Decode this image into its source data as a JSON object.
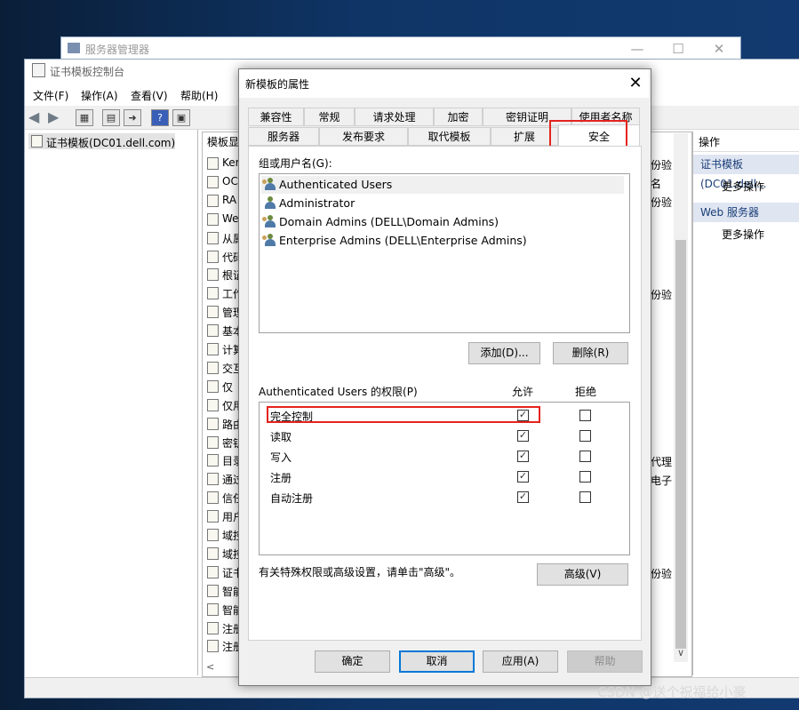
{
  "server_manager": {
    "title": "服务器管理器",
    "controls": [
      "—",
      "☐",
      "✕"
    ]
  },
  "console": {
    "title": "证书模板控制台",
    "menu": [
      "文件(F)",
      "操作(A)",
      "查看(V)",
      "帮助(H)"
    ],
    "tree_root": "证书模板(DC01.dell.com)",
    "list_header": "模板显",
    "list_rows": [
      "Ker",
      "OC",
      "RA",
      "We",
      "从属",
      "代码",
      "根证",
      "工作",
      "管理",
      "基本",
      "计算",
      "交互",
      "仅",
      "仅用",
      "路由",
      "密钥",
      "目录",
      "通过",
      "信任",
      "用户",
      "域控",
      "域控",
      "证书",
      "智能",
      "智能",
      "注册",
      "注册"
    ],
    "right_col": [
      {
        "row": 1,
        "text": "份验"
      },
      {
        "row": 2,
        "text": "名"
      },
      {
        "row": 3,
        "text": "份验"
      },
      {
        "row": 8,
        "text": "份验"
      },
      {
        "row": 17,
        "text": "代理"
      },
      {
        "row": 18,
        "text": "电子"
      },
      {
        "row": 23,
        "text": "份验"
      }
    ],
    "actions": {
      "header": "操作",
      "sections": [
        {
          "title": "证书模板(DC01.dell...",
          "more": "更多操作"
        },
        {
          "title": "Web 服务器",
          "more": "更多操作"
        }
      ]
    }
  },
  "dialog": {
    "title": "新模板的属性",
    "close": "✕",
    "tabs_row1": [
      "兼容性",
      "常规",
      "请求处理",
      "加密",
      "密钥证明",
      "使用者名称"
    ],
    "tabs_row2": [
      "服务器",
      "发布要求",
      "取代模板",
      "扩展",
      "安全"
    ],
    "active_tab": "安全",
    "groups_label": "组或用户名(G):",
    "users": [
      {
        "name": "Authenticated Users",
        "icon": "group-icon"
      },
      {
        "name": "Administrator",
        "icon": "user-icon"
      },
      {
        "name": "Domain Admins (DELL\\Domain Admins)",
        "icon": "group-icon"
      },
      {
        "name": "Enterprise Admins (DELL\\Enterprise Admins)",
        "icon": "group-icon"
      }
    ],
    "add_button": "添加(D)...",
    "remove_button": "删除(R)",
    "perm_label": "Authenticated Users 的权限(P)",
    "allow_header": "允许",
    "deny_header": "拒绝",
    "permissions": [
      {
        "name": "完全控制",
        "allow": true,
        "deny": false
      },
      {
        "name": "读取",
        "allow": true,
        "deny": false
      },
      {
        "name": "写入",
        "allow": true,
        "deny": false
      },
      {
        "name": "注册",
        "allow": true,
        "deny": false
      },
      {
        "name": "自动注册",
        "allow": true,
        "deny": false
      }
    ],
    "advanced_text": "有关特殊权限或高级设置，请单击\"高级\"。",
    "advanced_button": "高级(V)",
    "ok": "确定",
    "cancel": "取消",
    "apply": "应用(A)",
    "help": "帮助"
  },
  "watermark": "CSDN @送个祝福给小豪",
  "colors": {
    "highlight": "#e5231e",
    "accent": "#0078d7"
  }
}
